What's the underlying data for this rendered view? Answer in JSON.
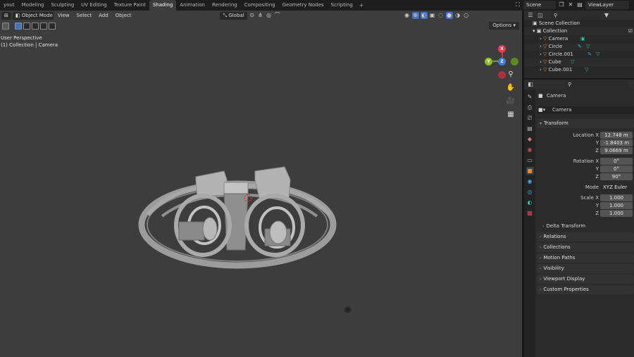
{
  "workspaces": {
    "tabs": [
      "yout",
      "Modeling",
      "Sculpting",
      "UV Editing",
      "Texture Paint",
      "Shading",
      "Animation",
      "Rendering",
      "Compositing",
      "Geometry Nodes",
      "Scripting"
    ],
    "active": "Shading",
    "add_label": "+"
  },
  "scene": {
    "name": "Scene",
    "view_layer": "ViewLayer"
  },
  "viewport": {
    "mode": "Object Mode",
    "menus": [
      "View",
      "Select",
      "Add",
      "Object"
    ],
    "orientation": "Global",
    "options_label": "Options",
    "info_line1": "User Perspective",
    "info_line2": "(1) Collection | Camera",
    "gizmo": {
      "x": "X",
      "y": "Y",
      "z": "Z"
    }
  },
  "outliner": {
    "scene_collection": "Scene Collection",
    "collection": "Collection",
    "objects": [
      "Camera",
      "Circle",
      "Circle.001",
      "Cube",
      "Cube.001"
    ]
  },
  "properties": {
    "object_name": "Camera",
    "data_name": "Camera",
    "transform_label": "Transform",
    "location": {
      "label": "Location X",
      "x": "12.748 m",
      "y": "-1.8403 m",
      "z": "9.0669 m"
    },
    "rotation": {
      "label": "Rotation X",
      "x": "0°",
      "y": "0°",
      "z": "90°"
    },
    "mode": {
      "label": "Mode",
      "value": "XYZ Euler"
    },
    "scale": {
      "label": "Scale X",
      "x": "1.000",
      "y": "1.000",
      "z": "1.000"
    },
    "axis_y": "Y",
    "axis_z": "Z",
    "delta_transform": "Delta Transform",
    "sections": [
      "Relations",
      "Collections",
      "Motion Paths",
      "Visibility",
      "Viewport Display",
      "Custom Properties"
    ]
  },
  "colors": {
    "accent_blue": "#4772b3",
    "gizmo_x": "#e0404e",
    "gizmo_y": "#8cbf24",
    "gizmo_z": "#3a7fe0",
    "object_orange": "#e08a3a"
  },
  "icons": [
    "editor-type-icon",
    "filter-icon",
    "search-icon",
    "zoom-icon",
    "hand-icon",
    "camera-view-icon",
    "grid-icon",
    "wrench-icon",
    "object-icon",
    "scene-icon",
    "world-icon"
  ]
}
